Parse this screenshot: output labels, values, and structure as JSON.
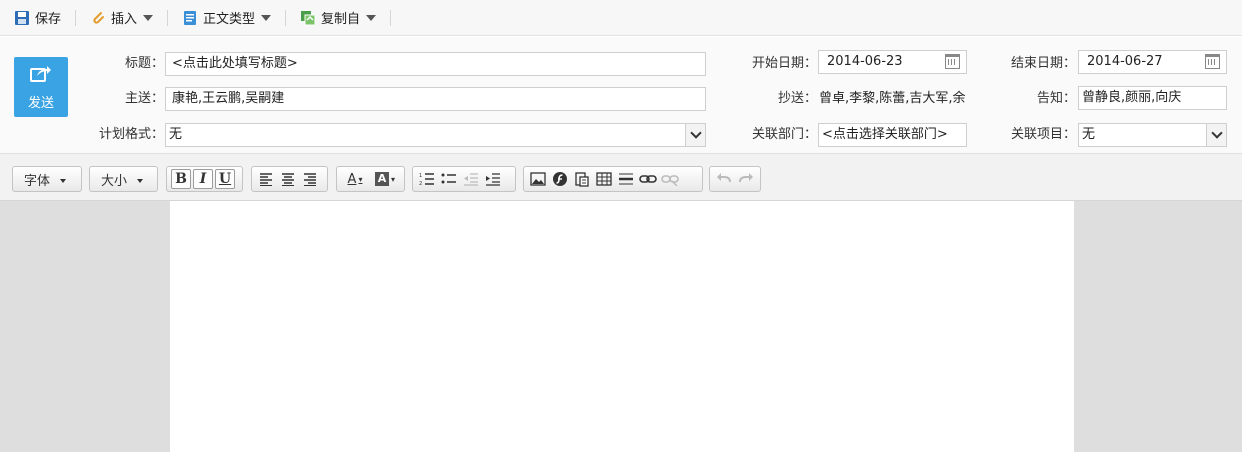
{
  "toolbar": {
    "save_label": "保存",
    "insert_label": "插入",
    "body_type_label": "正文类型",
    "copy_from_label": "复制自",
    "icons": {
      "save": "floppy-disk-icon",
      "insert": "paperclip-icon",
      "body_type": "document-icon",
      "copy_from": "copy-icon"
    }
  },
  "send_button": {
    "label": "发送",
    "icon": "share-arrow-icon",
    "color": "#3aa3e3"
  },
  "form": {
    "title_label": "标题：",
    "title_value": "<点击此处填写标题>",
    "main_send_label": "主送：",
    "main_send_value": "康艳,王云鹏,吴嗣建",
    "plan_format_label": "计划格式：",
    "plan_format_value": "无",
    "start_date_label": "开始日期：",
    "start_date_value": "2014-06-23",
    "cc_label": "抄送：",
    "cc_value": "曾卓,李黎,陈蕾,吉大军,余",
    "related_dept_label": "关联部门：",
    "related_dept_value": "<点击选择关联部门>",
    "end_date_label": "结束日期：",
    "end_date_value": "2014-06-27",
    "notify_label": "告知：",
    "notify_value": "曾静良,颜丽,向庆",
    "related_project_label": "关联项目：",
    "related_project_value": "无"
  },
  "editor_toolbar": {
    "font_label": "字体",
    "size_label": "大小",
    "bold": "B",
    "italic": "I",
    "underline": "U",
    "font_color": "A",
    "bg_color": "A"
  }
}
